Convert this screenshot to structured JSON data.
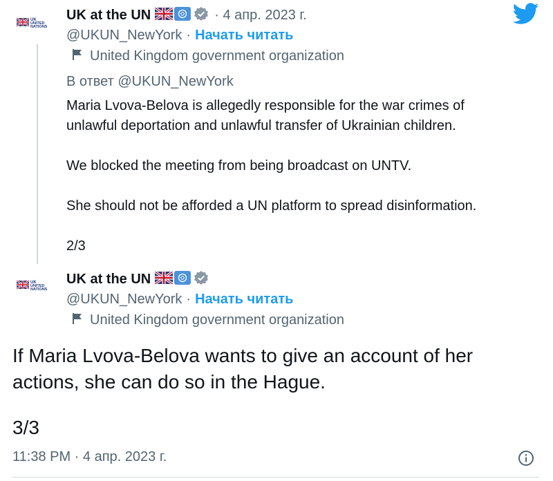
{
  "colors": {
    "accent": "#1d9bf0",
    "muted": "#536471",
    "text": "#0f1419",
    "verified": "#8b98a5"
  },
  "reply_tweet": {
    "display_name": "UK at the UN",
    "date": "· 4 апр. 2023 г.",
    "handle": "@UKUN_NewYork",
    "separator": "·",
    "follow_label": "Начать читать",
    "org_label": "United Kingdom government organization",
    "reply_to": "В ответ @UKUN_NewYork",
    "lines": [
      "Maria Lvova-Belova is allegedly responsible for the war crimes of",
      "unlawful deportation and unlawful transfer of Ukrainian children.",
      "We blocked the meeting from being broadcast on UNTV.",
      "She should not be afforded a UN platform to spread disinformation.",
      "2/3"
    ]
  },
  "main_tweet": {
    "display_name": "UK at the UN",
    "handle": "@UKUN_NewYork",
    "separator": "·",
    "follow_label": "Начать читать",
    "org_label": "United Kingdom government organization",
    "lines": [
      "If Maria Lvova-Belova wants to give an account of her",
      "actions, she can do so in the Hague.",
      "3/3"
    ],
    "timestamp": "11:38 PM · 4 апр. 2023 г."
  },
  "avatar_text": {
    "line1": "UK",
    "line2": "UNITED",
    "line3": "NATIONS"
  },
  "icons": [
    "twitter-logo-icon",
    "uk-flag-icon",
    "un-flag-icon",
    "verified-badge-icon",
    "government-flag-icon",
    "info-icon"
  ]
}
